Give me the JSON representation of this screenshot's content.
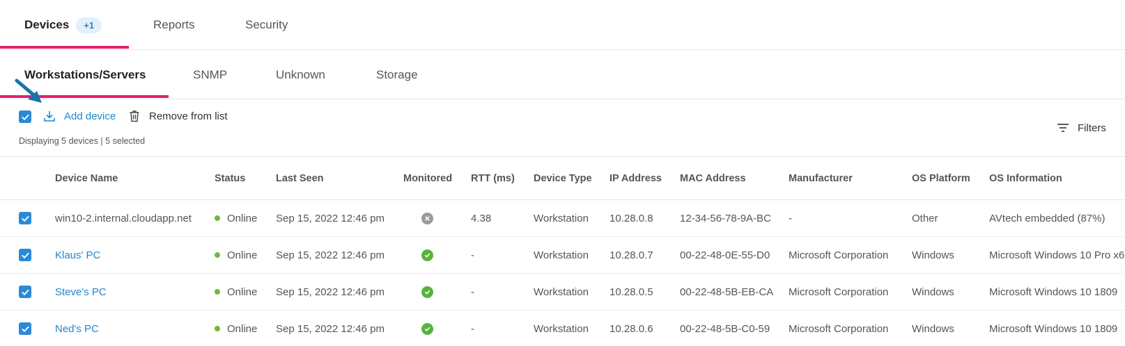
{
  "top_tabs": [
    {
      "label": "Devices",
      "badge": "+1",
      "active": true
    },
    {
      "label": "Reports",
      "active": false
    },
    {
      "label": "Security",
      "active": false
    }
  ],
  "sub_tabs": [
    {
      "label": "Workstations/Servers",
      "active": true
    },
    {
      "label": "SNMP",
      "active": false
    },
    {
      "label": "Unknown",
      "active": false
    },
    {
      "label": "Storage",
      "active": false
    }
  ],
  "toolbar": {
    "add_device_label": "Add device",
    "remove_label": "Remove from list",
    "status_text": "Displaying 5 devices | 5 selected",
    "filters_label": "Filters",
    "select_all_checked": true
  },
  "table": {
    "columns": [
      "Device Name",
      "Status",
      "Last Seen",
      "Monitored",
      "RTT (ms)",
      "Device Type",
      "IP Address",
      "MAC Address",
      "Manufacturer",
      "OS Platform",
      "OS Information"
    ],
    "rows": [
      {
        "name": "win10-2.internal.cloudapp.net",
        "link": false,
        "status": "Online",
        "last_seen": "Sep 15, 2022 12:46 pm",
        "monitored": false,
        "rtt": "4.38",
        "type": "Workstation",
        "ip": "10.28.0.8",
        "mac": "12-34-56-78-9A-BC",
        "manufacturer": "-",
        "os_platform": "Other",
        "os_info": "AVtech embedded (87%)"
      },
      {
        "name": "Klaus' PC",
        "link": true,
        "status": "Online",
        "last_seen": "Sep 15, 2022 12:46 pm",
        "monitored": true,
        "rtt": "-",
        "type": "Workstation",
        "ip": "10.28.0.7",
        "mac": "00-22-48-0E-55-D0",
        "manufacturer": "Microsoft Corporation",
        "os_platform": "Windows",
        "os_info": "Microsoft Windows 10 Pro x6"
      },
      {
        "name": "Steve's PC",
        "link": true,
        "status": "Online",
        "last_seen": "Sep 15, 2022 12:46 pm",
        "monitored": true,
        "rtt": "-",
        "type": "Workstation",
        "ip": "10.28.0.5",
        "mac": "00-22-48-5B-EB-CA",
        "manufacturer": "Microsoft Corporation",
        "os_platform": "Windows",
        "os_info": "Microsoft Windows 10 1809"
      },
      {
        "name": "Ned's PC",
        "link": true,
        "status": "Online",
        "last_seen": "Sep 15, 2022 12:46 pm",
        "monitored": true,
        "rtt": "-",
        "type": "Workstation",
        "ip": "10.28.0.6",
        "mac": "00-22-48-5B-C0-59",
        "manufacturer": "Microsoft Corporation",
        "os_platform": "Windows",
        "os_info": "Microsoft Windows 10 1809"
      }
    ]
  },
  "colors": {
    "accent_pink": "#e0206e",
    "link_blue": "#1e88cf",
    "checkbox_blue": "#2a8ad8",
    "online_green": "#6cbc3a",
    "monitored_green": "#58b33e",
    "unmonitored_gray": "#9a9a9a"
  },
  "icons": {
    "add_device": "download-icon",
    "remove": "trash-icon",
    "filters": "filter-lines-icon",
    "pointer": "pointer-arrow-icon"
  }
}
